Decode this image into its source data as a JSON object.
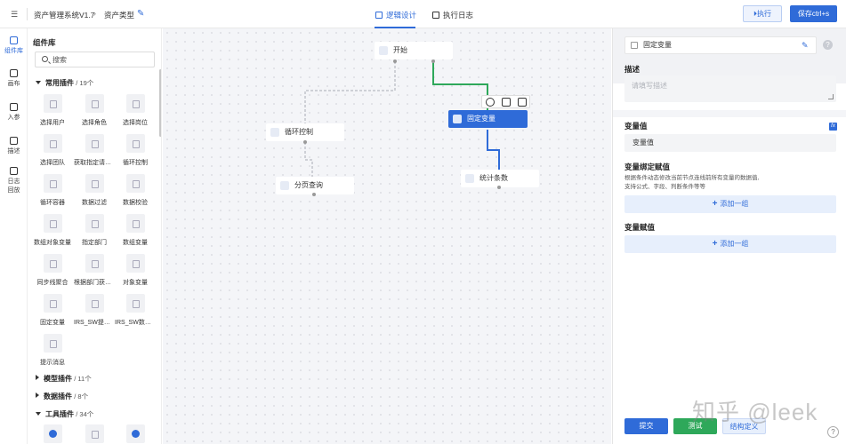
{
  "header": {
    "app_title": "资产管理系统V1.7",
    "breadcrumb_current": "资产类型",
    "tabs": [
      {
        "label": "逻辑设计",
        "active": true
      },
      {
        "label": "执行日志",
        "active": false
      }
    ],
    "exec_label": "执行",
    "save_label": "保存ctrl+s"
  },
  "rail": {
    "items": [
      {
        "label": "组件库",
        "active": true
      },
      {
        "label": "画布"
      },
      {
        "label": "入参"
      },
      {
        "label": "描述"
      },
      {
        "label_l1": "日志",
        "label_l2": "回放"
      }
    ]
  },
  "library": {
    "title": "组件库",
    "search_placeholder": "搜索",
    "groups": [
      {
        "name": "常用插件",
        "count": "/ 19个",
        "expanded": true
      },
      {
        "name": "模型插件",
        "count": "/ 11个",
        "expanded": false
      },
      {
        "name": "数据插件",
        "count": "/ 8个",
        "expanded": false
      },
      {
        "name": "工具插件",
        "count": "/ 34个",
        "expanded": true
      }
    ],
    "common_plugins": [
      "选择用户",
      "选择角色",
      "选择岗位",
      "选择团队",
      "获取指定请求...",
      "循环控制",
      "循环容器",
      "数据过滤",
      "数据校验",
      "数组对象变量",
      "指定部门",
      "数组变量",
      "同步线聚合",
      "根据部门获取...",
      "对象变量",
      "固定变量",
      "IRS_SW提交...",
      "IRS_SW数据...",
      "提示消息"
    ]
  },
  "canvas": {
    "nodes": {
      "start": "开始",
      "loop": "循环控制",
      "fixed": "固定变量",
      "page": "分页查询",
      "count": "统计条数"
    }
  },
  "props": {
    "node_name": "固定变量",
    "desc_label": "描述",
    "desc_placeholder": "请填写描述",
    "value_label": "变量值",
    "value_field": "变量值",
    "bind_label": "变量绑定赋值",
    "bind_hint_1": "根据条件动态修改当前节点连线前所有变量的数据值,",
    "bind_hint_2": "支持公式、字段、判断条件等等",
    "add_group": "添加一组",
    "assign_label": "变量赋值",
    "submit": "提交",
    "test": "测试",
    "struct": "结构定义",
    "fx": "fx"
  },
  "watermark": "知乎 @leek",
  "colors": {
    "primary": "#2f6bd8",
    "success": "#2ea85a",
    "edge_active_green": "#2ea85a",
    "edge_active_blue": "#2f6bd8"
  }
}
